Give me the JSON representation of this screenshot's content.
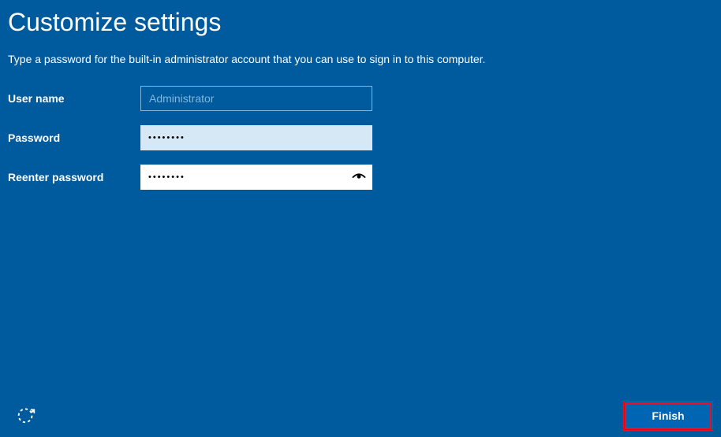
{
  "title": "Customize settings",
  "description": "Type a password for the built-in administrator account that you can use to sign in to this computer.",
  "form": {
    "username_label": "User name",
    "username_value": "Administrator",
    "password_label": "Password",
    "password_value": "••••••••",
    "reenter_label": "Reenter password",
    "reenter_value": "••••••••"
  },
  "buttons": {
    "finish": "Finish"
  }
}
